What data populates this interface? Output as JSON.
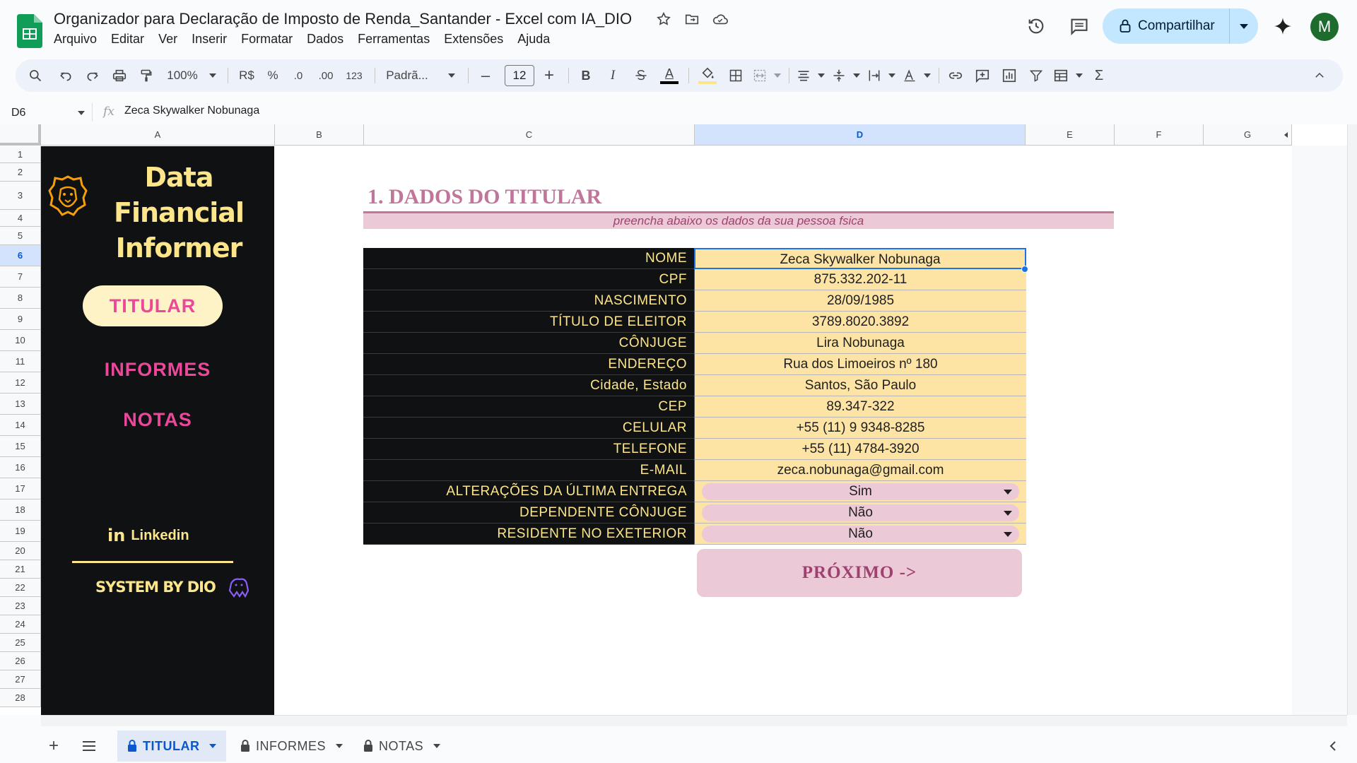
{
  "app": {
    "title": "Organizador para Declaração de Imposto de Renda_Santander - Excel com IA_DIO",
    "menu": [
      "Arquivo",
      "Editar",
      "Ver",
      "Inserir",
      "Formatar",
      "Dados",
      "Ferramentas",
      "Extensões",
      "Ajuda"
    ],
    "share_label": "Compartilhar",
    "avatar_letter": "M"
  },
  "toolbar": {
    "zoom": "100%",
    "currency": "R$",
    "percent": "%",
    "decimal_decrease": ".0",
    "decimal_increase": ".00",
    "number_format": "123",
    "font": "Padrã...",
    "font_size": "12",
    "bold": "B",
    "italic": "I",
    "font_color_letter": "A",
    "sum": "Σ"
  },
  "formula_bar": {
    "cell_ref": "D6",
    "fx": "fx",
    "content": "Zeca Skywalker Nobunaga"
  },
  "columns": [
    "A",
    "B",
    "C",
    "D",
    "E",
    "F",
    "G"
  ],
  "rows": [
    "1",
    "2",
    "3",
    "4",
    "5",
    "6",
    "7",
    "8",
    "9",
    "10",
    "11",
    "12",
    "13",
    "14",
    "15",
    "16",
    "17",
    "18",
    "19",
    "20",
    "21",
    "22",
    "23",
    "24",
    "25",
    "26",
    "27",
    "28"
  ],
  "active_cell": {
    "column": "D",
    "row": "6"
  },
  "sidebar": {
    "brand_line1": "Data Financial",
    "brand_line2": "Informer",
    "nav_active": "TITULAR",
    "nav_informes": "INFORMES",
    "nav_notas": "NOTAS",
    "linkedin_icon": "in",
    "linkedin_label": "Linkedin",
    "system_by": "SYSTEM BY DIO"
  },
  "section": {
    "title": "1. DADOS DO TITULAR",
    "subtitle": "preencha abaixo os dados da sua pessoa fsica"
  },
  "table": [
    {
      "label": "NOME",
      "value": "Zeca Skywalker Nobunaga"
    },
    {
      "label": "CPF",
      "value": "875.332.202-11"
    },
    {
      "label": "NASCIMENTO",
      "value": "28/09/1985"
    },
    {
      "label": "TÍTULO DE ELEITOR",
      "value": "3789.8020.3892"
    },
    {
      "label": "CÔNJUGE",
      "value": "Lira Nobunaga"
    },
    {
      "label": "ENDEREÇO",
      "value": "Rua dos Limoeiros nº 180"
    },
    {
      "label": "Cidade, Estado",
      "value": "Santos, São Paulo"
    },
    {
      "label": "CEP",
      "value": "89.347-322"
    },
    {
      "label": "CELULAR",
      "value": "+55 (11) 9 9348-8285"
    },
    {
      "label": "TELEFONE",
      "value": "+55 (11) 4784-3920"
    },
    {
      "label": "E-MAIL",
      "value": "zeca.nobunaga@gmail.com"
    },
    {
      "label": "ALTERAÇÕES DA ÚLTIMA ENTREGA",
      "value": "Sim"
    },
    {
      "label": "DEPENDENTE CÔNJUGE",
      "value": "Não"
    },
    {
      "label": "RESIDENTE NO EXETERIOR",
      "value": "Não"
    }
  ],
  "next_button": "PRÓXIMO ->",
  "sheets": [
    "TITULAR",
    "INFORMES",
    "NOTAS"
  ],
  "colors": {
    "accent_pink": "#c0759a",
    "brand_yellow": "#fde68a",
    "nav_pink": "#ec4899",
    "panel_dark": "#0f1113",
    "cell_yellow": "#fde4a5"
  },
  "icons": [
    "sheets-logo-icon",
    "star-icon",
    "move-folder-icon",
    "cloud-icon",
    "history-icon",
    "comment-icon",
    "lock-icon",
    "gemini-icon",
    "search-icon",
    "undo-icon",
    "redo-icon",
    "print-icon",
    "paint-format-icon",
    "strikethrough-icon",
    "fill-color-icon",
    "borders-icon",
    "merge-icon",
    "align-icon",
    "valign-icon",
    "wrap-icon",
    "rotate-icon",
    "link-icon",
    "add-comment-icon",
    "chart-icon",
    "filter-icon",
    "table-icon",
    "collapse-icon",
    "lion-icon",
    "add-sheet-icon",
    "all-sheets-icon"
  ]
}
